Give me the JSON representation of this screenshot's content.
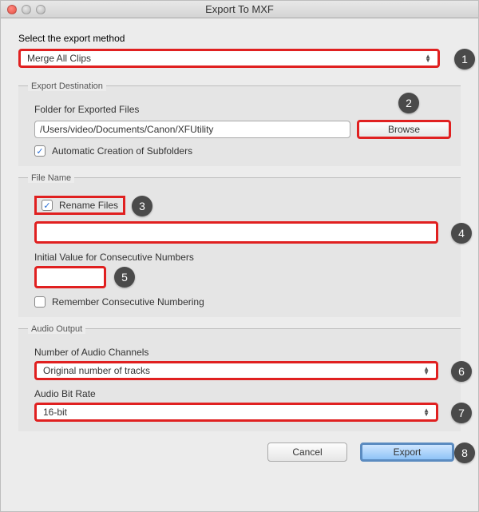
{
  "window": {
    "title": "Export To MXF"
  },
  "export_method": {
    "label": "Select the export method",
    "value": "Merge All Clips"
  },
  "destination": {
    "legend": "Export Destination",
    "folder_label": "Folder for Exported Files",
    "folder_value": "/Users/video/Documents/Canon/XFUtility",
    "browse_label": "Browse",
    "auto_subfolders_label": "Automatic Creation of Subfolders",
    "auto_subfolders_checked": true
  },
  "filename": {
    "legend": "File Name",
    "rename_label": "Rename Files",
    "rename_checked": true,
    "name_value": "",
    "initial_label": "Initial Value for Consecutive Numbers",
    "initial_value": "",
    "remember_label": "Remember Consecutive Numbering",
    "remember_checked": false
  },
  "audio": {
    "legend": "Audio Output",
    "channels_label": "Number of Audio Channels",
    "channels_value": "Original number of tracks",
    "bitrate_label": "Audio Bit Rate",
    "bitrate_value": "16-bit"
  },
  "footer": {
    "cancel_label": "Cancel",
    "export_label": "Export"
  },
  "callouts": [
    "1",
    "2",
    "3",
    "4",
    "5",
    "6",
    "7",
    "8"
  ]
}
